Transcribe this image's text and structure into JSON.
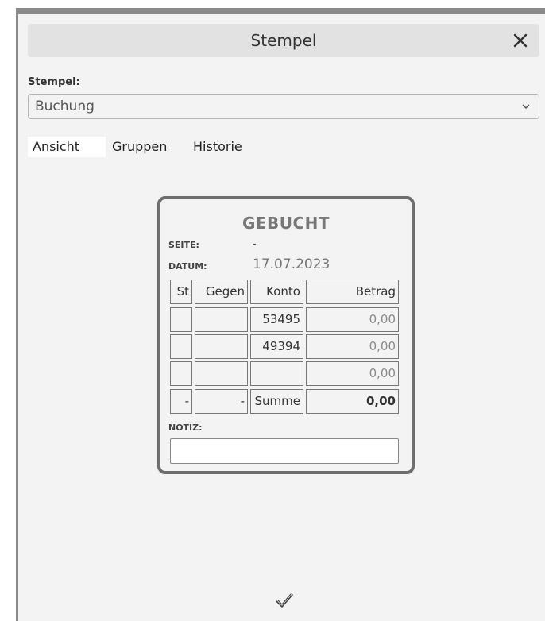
{
  "dialog": {
    "title": "Stempel",
    "close_icon": "close-icon"
  },
  "stempel_field": {
    "label": "Stempel:",
    "selected": "Buchung",
    "icon": "chevron-down-icon"
  },
  "tabs": [
    {
      "label": "Ansicht",
      "active": true
    },
    {
      "label": "Gruppen",
      "active": false
    },
    {
      "label": "Historie",
      "active": false
    }
  ],
  "stamp": {
    "title": "GEBUCHT",
    "seite_label": "SEITE:",
    "seite_value": "-",
    "datum_label": "DATUM:",
    "datum_value": "17.07.2023",
    "headers": {
      "st": "St",
      "gegen": "Gegen",
      "konto": "Konto",
      "betrag": "Betrag"
    },
    "rows": [
      {
        "st": "",
        "gegen": "",
        "konto": "53495",
        "betrag": "0,00"
      },
      {
        "st": "",
        "gegen": "",
        "konto": "49394",
        "betrag": "0,00"
      },
      {
        "st": "",
        "gegen": "",
        "konto": "",
        "betrag": "0,00"
      }
    ],
    "sum_row": {
      "st": "-",
      "gegen": "-",
      "konto": "Summe",
      "betrag": "0,00"
    },
    "notiz_label": "NOTIZ:",
    "notiz_value": ""
  },
  "footer": {
    "confirm_icon": "checkmark-icon"
  }
}
